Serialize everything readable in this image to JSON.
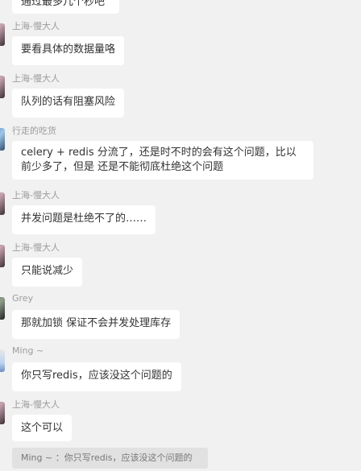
{
  "messages": [
    {
      "sender": "",
      "text": "通过最多几个秒吧"
    },
    {
      "sender": "上海-慢大人",
      "text": "要看具体的数据量咯"
    },
    {
      "sender": "上海-慢大人",
      "text": "队列的话有阻塞风险"
    },
    {
      "sender": "行走的吃货",
      "text": "celery + redis 分流了，还是时不时的会有这个问题，比以前少多了，但是 还是不能彻底杜绝这个问题"
    },
    {
      "sender": "上海-慢大人",
      "text": "并发问题是杜绝不了的……"
    },
    {
      "sender": "上海-慢大人",
      "text": "只能说减少"
    },
    {
      "sender": "Grey",
      "text": "那就加锁 保证不会并发处理库存"
    },
    {
      "sender": "Ming ~",
      "text": "你只写redis，应该没这个问题的"
    },
    {
      "sender": "上海-慢大人",
      "text": "这个可以"
    }
  ],
  "quote": {
    "text": "Ming ~ ：你只写redis，应该没这个问题的"
  }
}
